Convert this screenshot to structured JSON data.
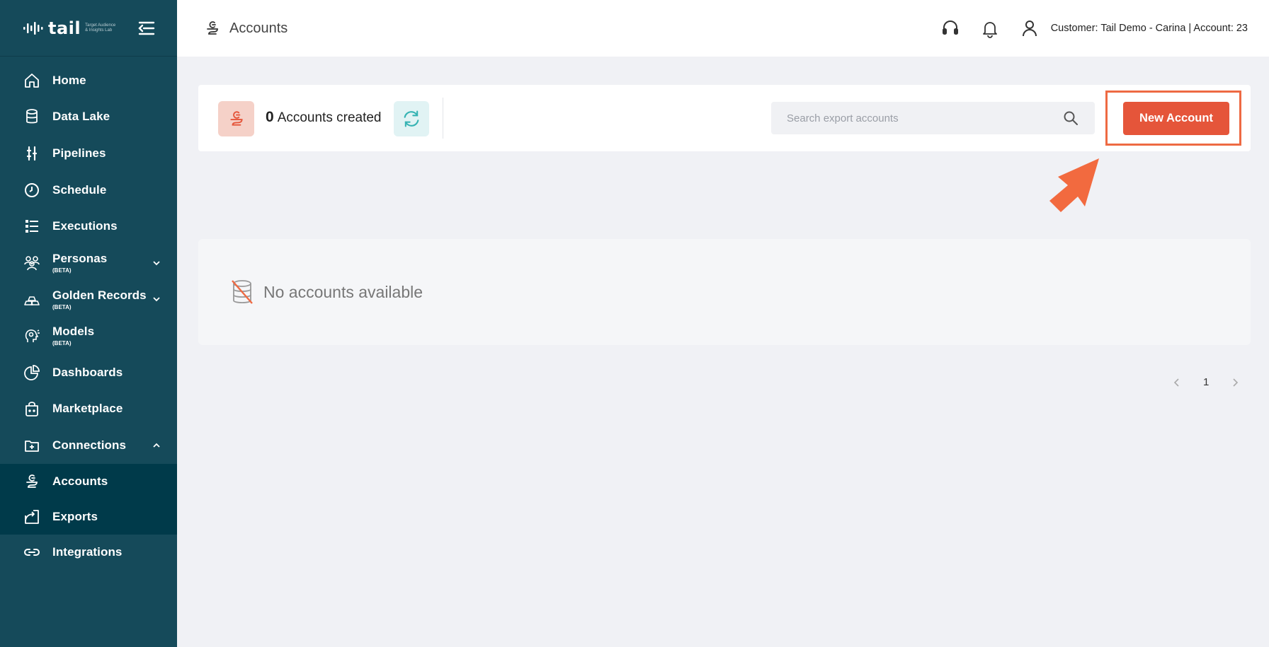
{
  "brand": {
    "word": "tail",
    "tagline": "Target Audience & Insights Lab"
  },
  "sidebar": {
    "items": [
      {
        "label": "Home",
        "icon": "home-icon"
      },
      {
        "label": "Data Lake",
        "icon": "database-icon"
      },
      {
        "label": "Pipelines",
        "icon": "pipeline-icon"
      },
      {
        "label": "Schedule",
        "icon": "clock-icon"
      },
      {
        "label": "Executions",
        "icon": "list-icon"
      },
      {
        "label": "Personas",
        "beta": "(BETA)",
        "icon": "people-icon",
        "expandable": true
      },
      {
        "label": "Golden Records",
        "beta": "(BETA)",
        "icon": "gold-bars-icon",
        "expandable": true
      },
      {
        "label": "Models",
        "beta": "(BETA)",
        "icon": "head-brain-icon"
      },
      {
        "label": "Dashboards",
        "icon": "pie-chart-icon"
      },
      {
        "label": "Marketplace",
        "icon": "shopping-bag-icon"
      },
      {
        "label": "Connections",
        "icon": "connections-icon",
        "expanded": true
      }
    ],
    "sub_items": [
      {
        "label": "Accounts",
        "icon": "accounts-icon"
      },
      {
        "label": "Exports",
        "icon": "export-icon"
      }
    ],
    "after": [
      {
        "label": "Integrations",
        "icon": "link-icon"
      }
    ]
  },
  "topbar": {
    "title": "Accounts",
    "user_text": "Customer: Tail Demo - Carina | Account: 23"
  },
  "summary": {
    "count": "0",
    "count_label": "Accounts created"
  },
  "search": {
    "placeholder": "Search export accounts"
  },
  "actions": {
    "new_account": "New Account"
  },
  "empty_state": {
    "message": "No accounts available"
  },
  "pagination": {
    "current_page": "1"
  },
  "colors": {
    "sidebar": "#154a5a",
    "sidebar_sub": "#003a4a",
    "accent": "#e5553a",
    "highlight": "#ee6a43",
    "refresh_bg": "#e1f3f4"
  }
}
